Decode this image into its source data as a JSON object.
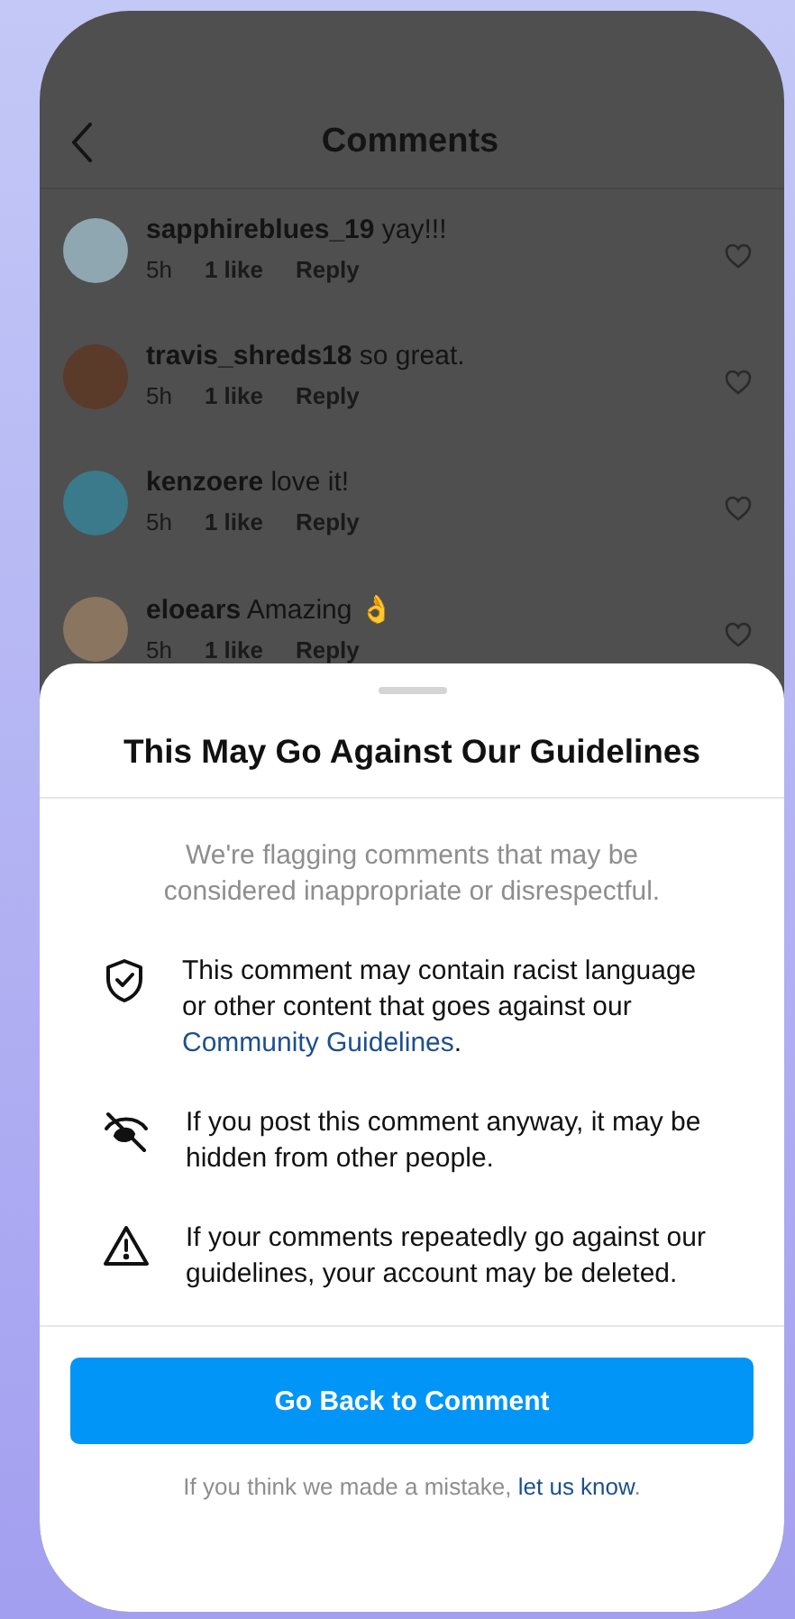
{
  "header": {
    "title": "Comments"
  },
  "comments": [
    {
      "username": "sapphireblues_19",
      "text": "yay!!!",
      "time": "5h",
      "likes": "1 like",
      "reply": "Reply"
    },
    {
      "username": "travis_shreds18",
      "text": "so great.",
      "time": "5h",
      "likes": "1 like",
      "reply": "Reply"
    },
    {
      "username": "kenzoere",
      "text": "love it!",
      "time": "5h",
      "likes": "1 like",
      "reply": "Reply"
    },
    {
      "username": "eloears",
      "text": "Amazing 👌",
      "time": "5h",
      "likes": "1 like",
      "reply": "Reply"
    }
  ],
  "sheet": {
    "title": "This May Go Against Our Guidelines",
    "subtitle": "We're flagging comments that may be considered inappropriate or disrespectful.",
    "items": [
      {
        "kind": "shield",
        "text": "This comment may contain racist language or other content that goes against our ",
        "link": "Community Guidelines",
        "after": "."
      },
      {
        "kind": "hidden",
        "text": "If you post this comment anyway, it may be hidden from other people."
      },
      {
        "kind": "warning",
        "text": "If your comments repeatedly go against our guidelines, your account may be deleted."
      }
    ],
    "button": "Go Back to Comment",
    "footer": {
      "text": "If you think we made a mistake, ",
      "link": "let us know",
      "after": "."
    }
  }
}
